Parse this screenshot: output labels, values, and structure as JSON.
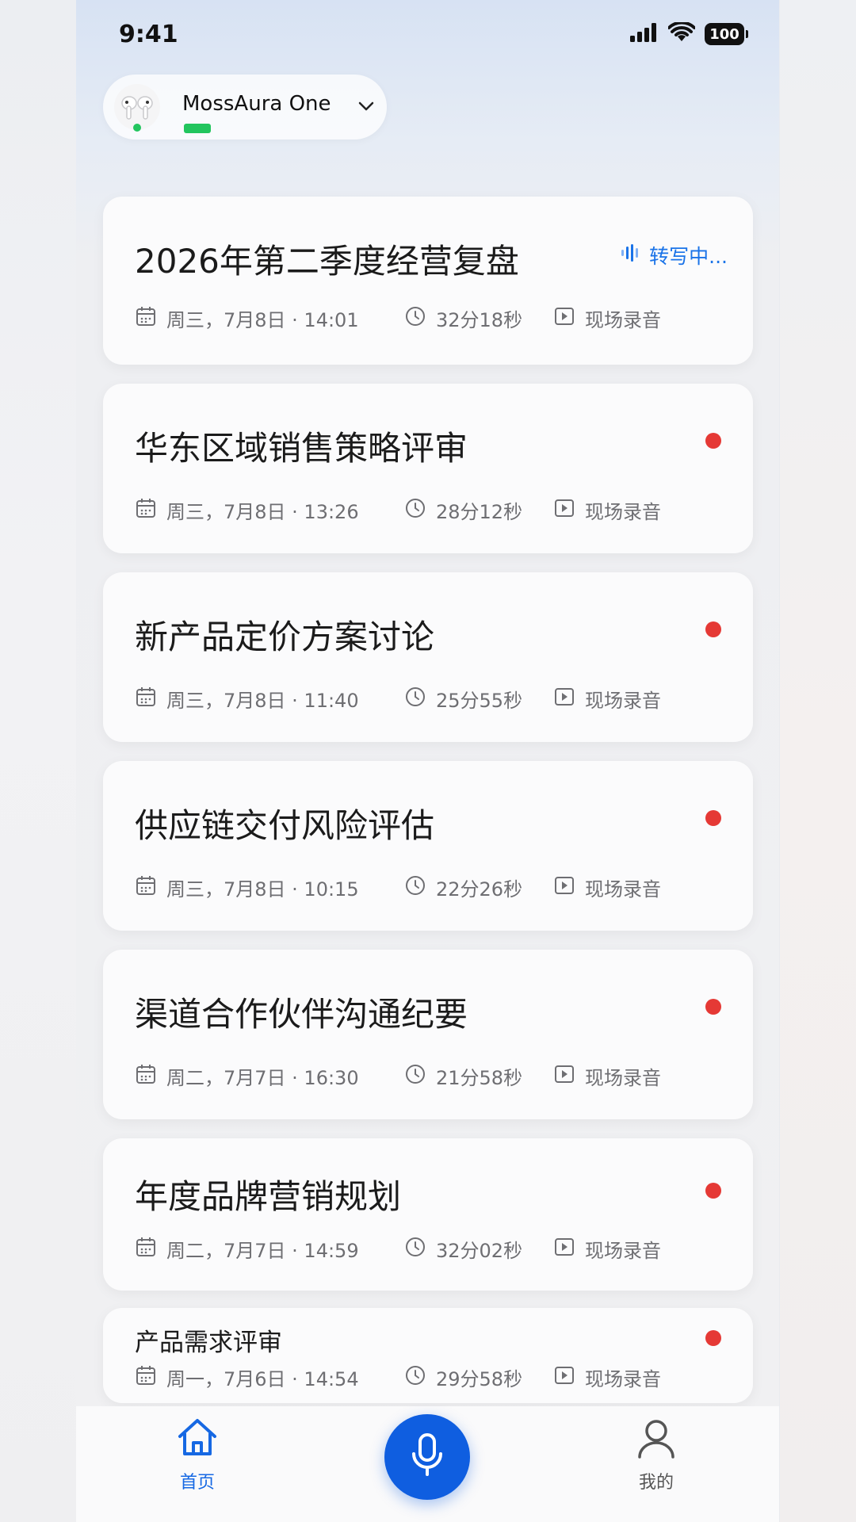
{
  "status_bar": {
    "time": "9:41",
    "battery": "100"
  },
  "device": {
    "name": "MossAura One"
  },
  "recordings": [
    {
      "title": "2026年第二季度经营复盘",
      "date": "周三，7月8日 · 14:01",
      "duration": "32分18秒",
      "source": "现场录音",
      "status": "转写中..."
    },
    {
      "title": "华东区域销售策略评审",
      "date": "周三，7月8日 · 13:26",
      "duration": "28分12秒",
      "source": "现场录音"
    },
    {
      "title": "新产品定价方案讨论",
      "date": "周三，7月8日 · 11:40",
      "duration": "25分55秒",
      "source": "现场录音"
    },
    {
      "title": "供应链交付风险评估",
      "date": "周三，7月8日 · 10:15",
      "duration": "22分26秒",
      "source": "现场录音"
    },
    {
      "title": "渠道合作伙伴沟通纪要",
      "date": "周二，7月7日 · 16:30",
      "duration": "21分58秒",
      "source": "现场录音"
    },
    {
      "title": "年度品牌营销规划",
      "date": "周二，7月7日 · 14:59",
      "duration": "32分02秒",
      "source": "现场录音"
    },
    {
      "title": "产品需求评审",
      "date": "周一，7月6日 · 14:54",
      "duration": "29分58秒",
      "source": "现场录音"
    }
  ],
  "tabs": {
    "home": "首页",
    "me": "我的"
  },
  "colors": {
    "accent": "#1668e3",
    "unread_dot": "#e53935",
    "online": "#22c55e"
  }
}
